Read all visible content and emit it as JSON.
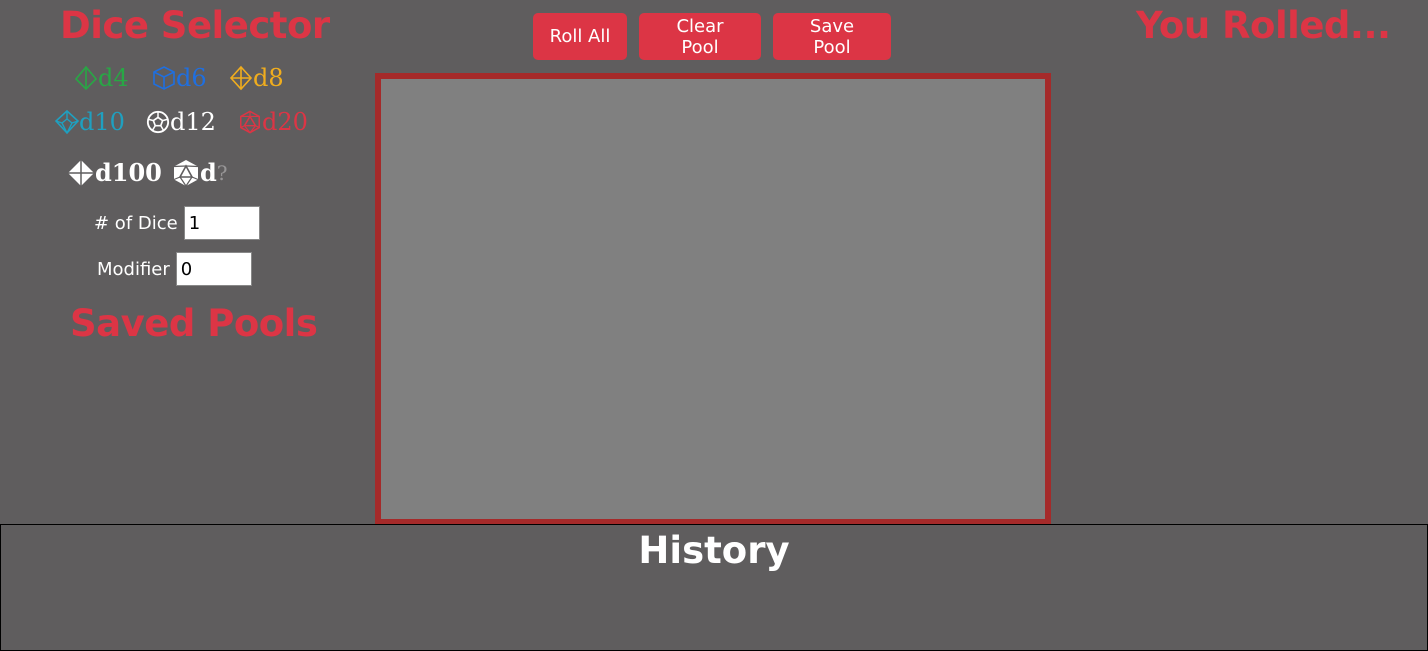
{
  "selector": {
    "title": "Dice Selector",
    "dice": [
      {
        "label": "d4",
        "color": "#28a745",
        "icon": "d4-icon"
      },
      {
        "label": "d6",
        "color": "#1f6fe0",
        "icon": "d6-icon"
      },
      {
        "label": "d8",
        "color": "#f0ad1e",
        "icon": "d8-icon"
      },
      {
        "label": "d10",
        "color": "#1fa0c0",
        "icon": "d10-icon"
      },
      {
        "label": "d12",
        "color": "#ffffff",
        "icon": "d12-icon"
      },
      {
        "label": "d20",
        "color": "#dc3545",
        "icon": "d20-icon"
      },
      {
        "label": "d100",
        "color": "#ffffff",
        "icon": "d100-icon"
      },
      {
        "label": "d",
        "suffix": "?",
        "color": "#ffffff",
        "icon": "custom-die-icon"
      }
    ],
    "num_dice": {
      "label": "# of Dice",
      "value": "1"
    },
    "modifier": {
      "label": "Modifier",
      "value": "0"
    }
  },
  "saved_pools": {
    "title": "Saved Pools"
  },
  "toolbar": {
    "roll_all": "Roll All",
    "clear_pool": "Clear Pool",
    "save_pool": "Save Pool"
  },
  "results": {
    "title": "You Rolled..."
  },
  "history": {
    "title": "History"
  },
  "colors": {
    "accent": "#dc3545",
    "background": "#5f5d5e",
    "pool_background": "#808080",
    "pool_border": "#a52a2a"
  }
}
